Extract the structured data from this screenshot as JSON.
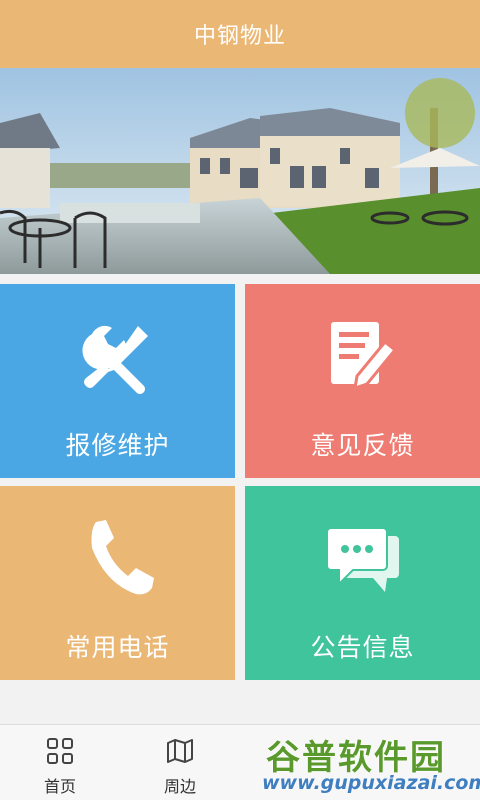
{
  "header": {
    "title": "中钢物业"
  },
  "banner": {
    "icon": "villa-photo"
  },
  "tiles": [
    {
      "label": "报修维护",
      "icon": "wrench-screwdriver-icon",
      "color": "#4aa7e3"
    },
    {
      "label": "意见反馈",
      "icon": "document-pen-icon",
      "color": "#ef7c72"
    },
    {
      "label": "常用电话",
      "icon": "phone-icon",
      "color": "#ebb774"
    },
    {
      "label": "公告信息",
      "icon": "chat-bubbles-icon",
      "color": "#3fc49b"
    }
  ],
  "tabbar": {
    "items": [
      {
        "label": "首页",
        "icon": "grid-icon"
      },
      {
        "label": "周边",
        "icon": "map-icon"
      },
      {
        "label": "",
        "icon": ""
      },
      {
        "label": "",
        "icon": ""
      }
    ]
  },
  "watermark": {
    "logo_text": "谷普软件园",
    "url": "www.gupuxiazai.com"
  },
  "colors": {
    "header": "#ebb774",
    "tab_text": "#333333"
  }
}
